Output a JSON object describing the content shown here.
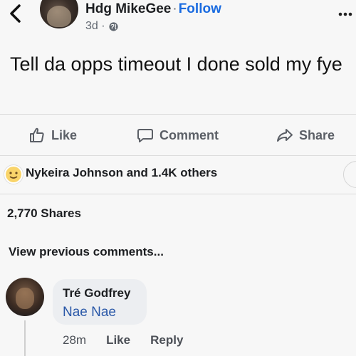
{
  "post": {
    "author": "Hdg MikeGee",
    "separator": "·",
    "follow_label": "Follow",
    "time": "3d ·",
    "text": "Tell da opps timeout I done sold my fye"
  },
  "actions": {
    "like": "Like",
    "comment": "Comment",
    "share": "Share"
  },
  "reactions": {
    "text": "Nykeira Johnson and 1.4K others"
  },
  "shares_text": "2,770 Shares",
  "view_previous": "View previous comments...",
  "comment": {
    "author": "Tré Godfrey",
    "text": "Nae Nae",
    "time": "28m",
    "like_label": "Like",
    "reply_label": "Reply"
  },
  "icons": {
    "back": "chevron-left-icon",
    "more": "more-dots-icon",
    "privacy": "globe-icon",
    "like": "thumbs-up-icon",
    "comment": "speech-bubble-icon",
    "share": "share-arrow-icon",
    "reaction": "emoji-reaction-icon"
  },
  "colors": {
    "link_blue": "#1a6be0",
    "comment_text_blue": "#2a58a8",
    "muted_gray": "#606770",
    "bubble_bg": "#eceef1"
  }
}
